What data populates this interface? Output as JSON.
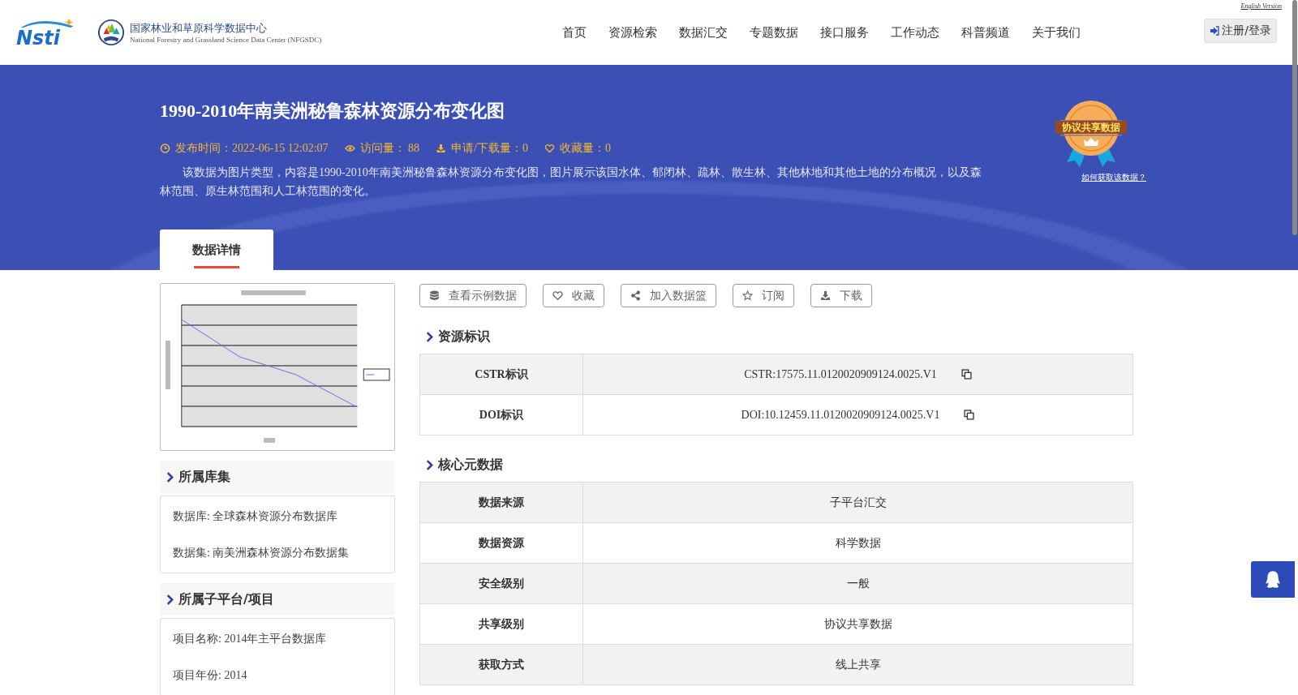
{
  "header": {
    "logo_text": "Nsti",
    "org_name": "国家林业和草原科学数据中心",
    "org_name_en": "National Forestry and Grassland Science Data Center (NFGSDC)",
    "nav": [
      {
        "label": "首页"
      },
      {
        "label": "资源检索"
      },
      {
        "label": "数据汇交"
      },
      {
        "label": "专题数据"
      },
      {
        "label": "接口服务"
      },
      {
        "label": "工作动态"
      },
      {
        "label": "科普频道"
      },
      {
        "label": "关于我们"
      }
    ],
    "english_link": "English Version",
    "login_button": "注册/登录"
  },
  "dataset": {
    "title": "1990-2010年南美洲秘鲁森林资源分布变化图",
    "meta": [
      {
        "kind": "clock",
        "text": "发布时间：2022-06-15 12:02:07"
      },
      {
        "kind": "eye",
        "text": "访问量： 88"
      },
      {
        "kind": "download",
        "text": "申请/下载量：0"
      },
      {
        "kind": "heart",
        "text": "收藏量：0"
      }
    ],
    "description": "该数据为图片类型，内容是1990-2010年南美洲秘鲁森林资源分布变化图，图片展示该国水体、郁闭林、疏林、散生林、其他林地和其他土地的分布概况，以及森林范围、原生林范围和人工林范围的变化。",
    "badge": {
      "label": "协议共享数据",
      "link": "如何获取该数据？"
    },
    "tabs": [
      {
        "label": "数据详情",
        "selected": true
      }
    ]
  },
  "sidebar": [
    {
      "title": "所属库集",
      "items": [
        "数据库: 全球森林资源分布数据库",
        "数据集: 南美洲森林资源分布数据集"
      ]
    },
    {
      "title": "所属子平台/项目",
      "items": [
        "项目名称: 2014年主平台数据库",
        "项目年份: 2014"
      ]
    }
  ],
  "actions": [
    {
      "kind": "database",
      "label": "查看示例数据"
    },
    {
      "kind": "heart",
      "label": "收藏"
    },
    {
      "kind": "share",
      "label": "加入数据篮"
    },
    {
      "kind": "star",
      "label": "订阅"
    },
    {
      "kind": "download",
      "label": "下载"
    }
  ],
  "sections": [
    {
      "title": "资源标识",
      "rows": [
        {
          "label": "CSTR标识",
          "value": "CSTR:17575.11.0120020909124.0025.V1",
          "copyable": true
        },
        {
          "label": "DOI标识",
          "value": "DOI:10.12459.11.0120020909124.0025.V1",
          "copyable": true
        }
      ]
    },
    {
      "title": "核心元数据",
      "rows": [
        {
          "label": "数据来源",
          "value": "子平台汇交",
          "copyable": false
        },
        {
          "label": "数据资源",
          "value": "科学数据",
          "copyable": false
        },
        {
          "label": "安全级别",
          "value": "一般",
          "copyable": false
        },
        {
          "label": "共享级别",
          "value": "协议共享数据",
          "copyable": false
        },
        {
          "label": "获取方式",
          "value": "线上共享",
          "copyable": false
        }
      ]
    }
  ]
}
